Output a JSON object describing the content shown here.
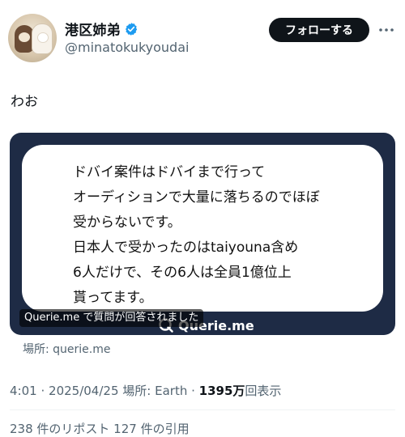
{
  "user": {
    "display_name": "港区姉弟",
    "handle": "@minatokukyoudai",
    "verified": true,
    "accent_color": "#1d9bf0"
  },
  "actions": {
    "follow_label": "フォローする",
    "more_icon": "more-horizontal-icon"
  },
  "tweet": {
    "text": "わお"
  },
  "media": {
    "background_color": "#1e2b45",
    "card_lines": [
      "ドバイ案件はドバイまで行って",
      "オーディションで大量に落ちるのでほぼ",
      "受からないです。",
      "日本人で受かったのはtaiyouna含め",
      "6人だけで、その6人は全員1億位上",
      "貰ってます。"
    ],
    "brand_name": "Querie.me",
    "caption": "Querie.me で質問が回答されました"
  },
  "source_label": "場所: querie.me",
  "meta": {
    "time": "4:01",
    "sep1": "·",
    "date": "2025/04/25",
    "location": "場所: Earth",
    "sep2": "·",
    "views_count": "1395万",
    "views_label": "回表示"
  },
  "stats_text": "238 件のリポスト 127 件の引用"
}
